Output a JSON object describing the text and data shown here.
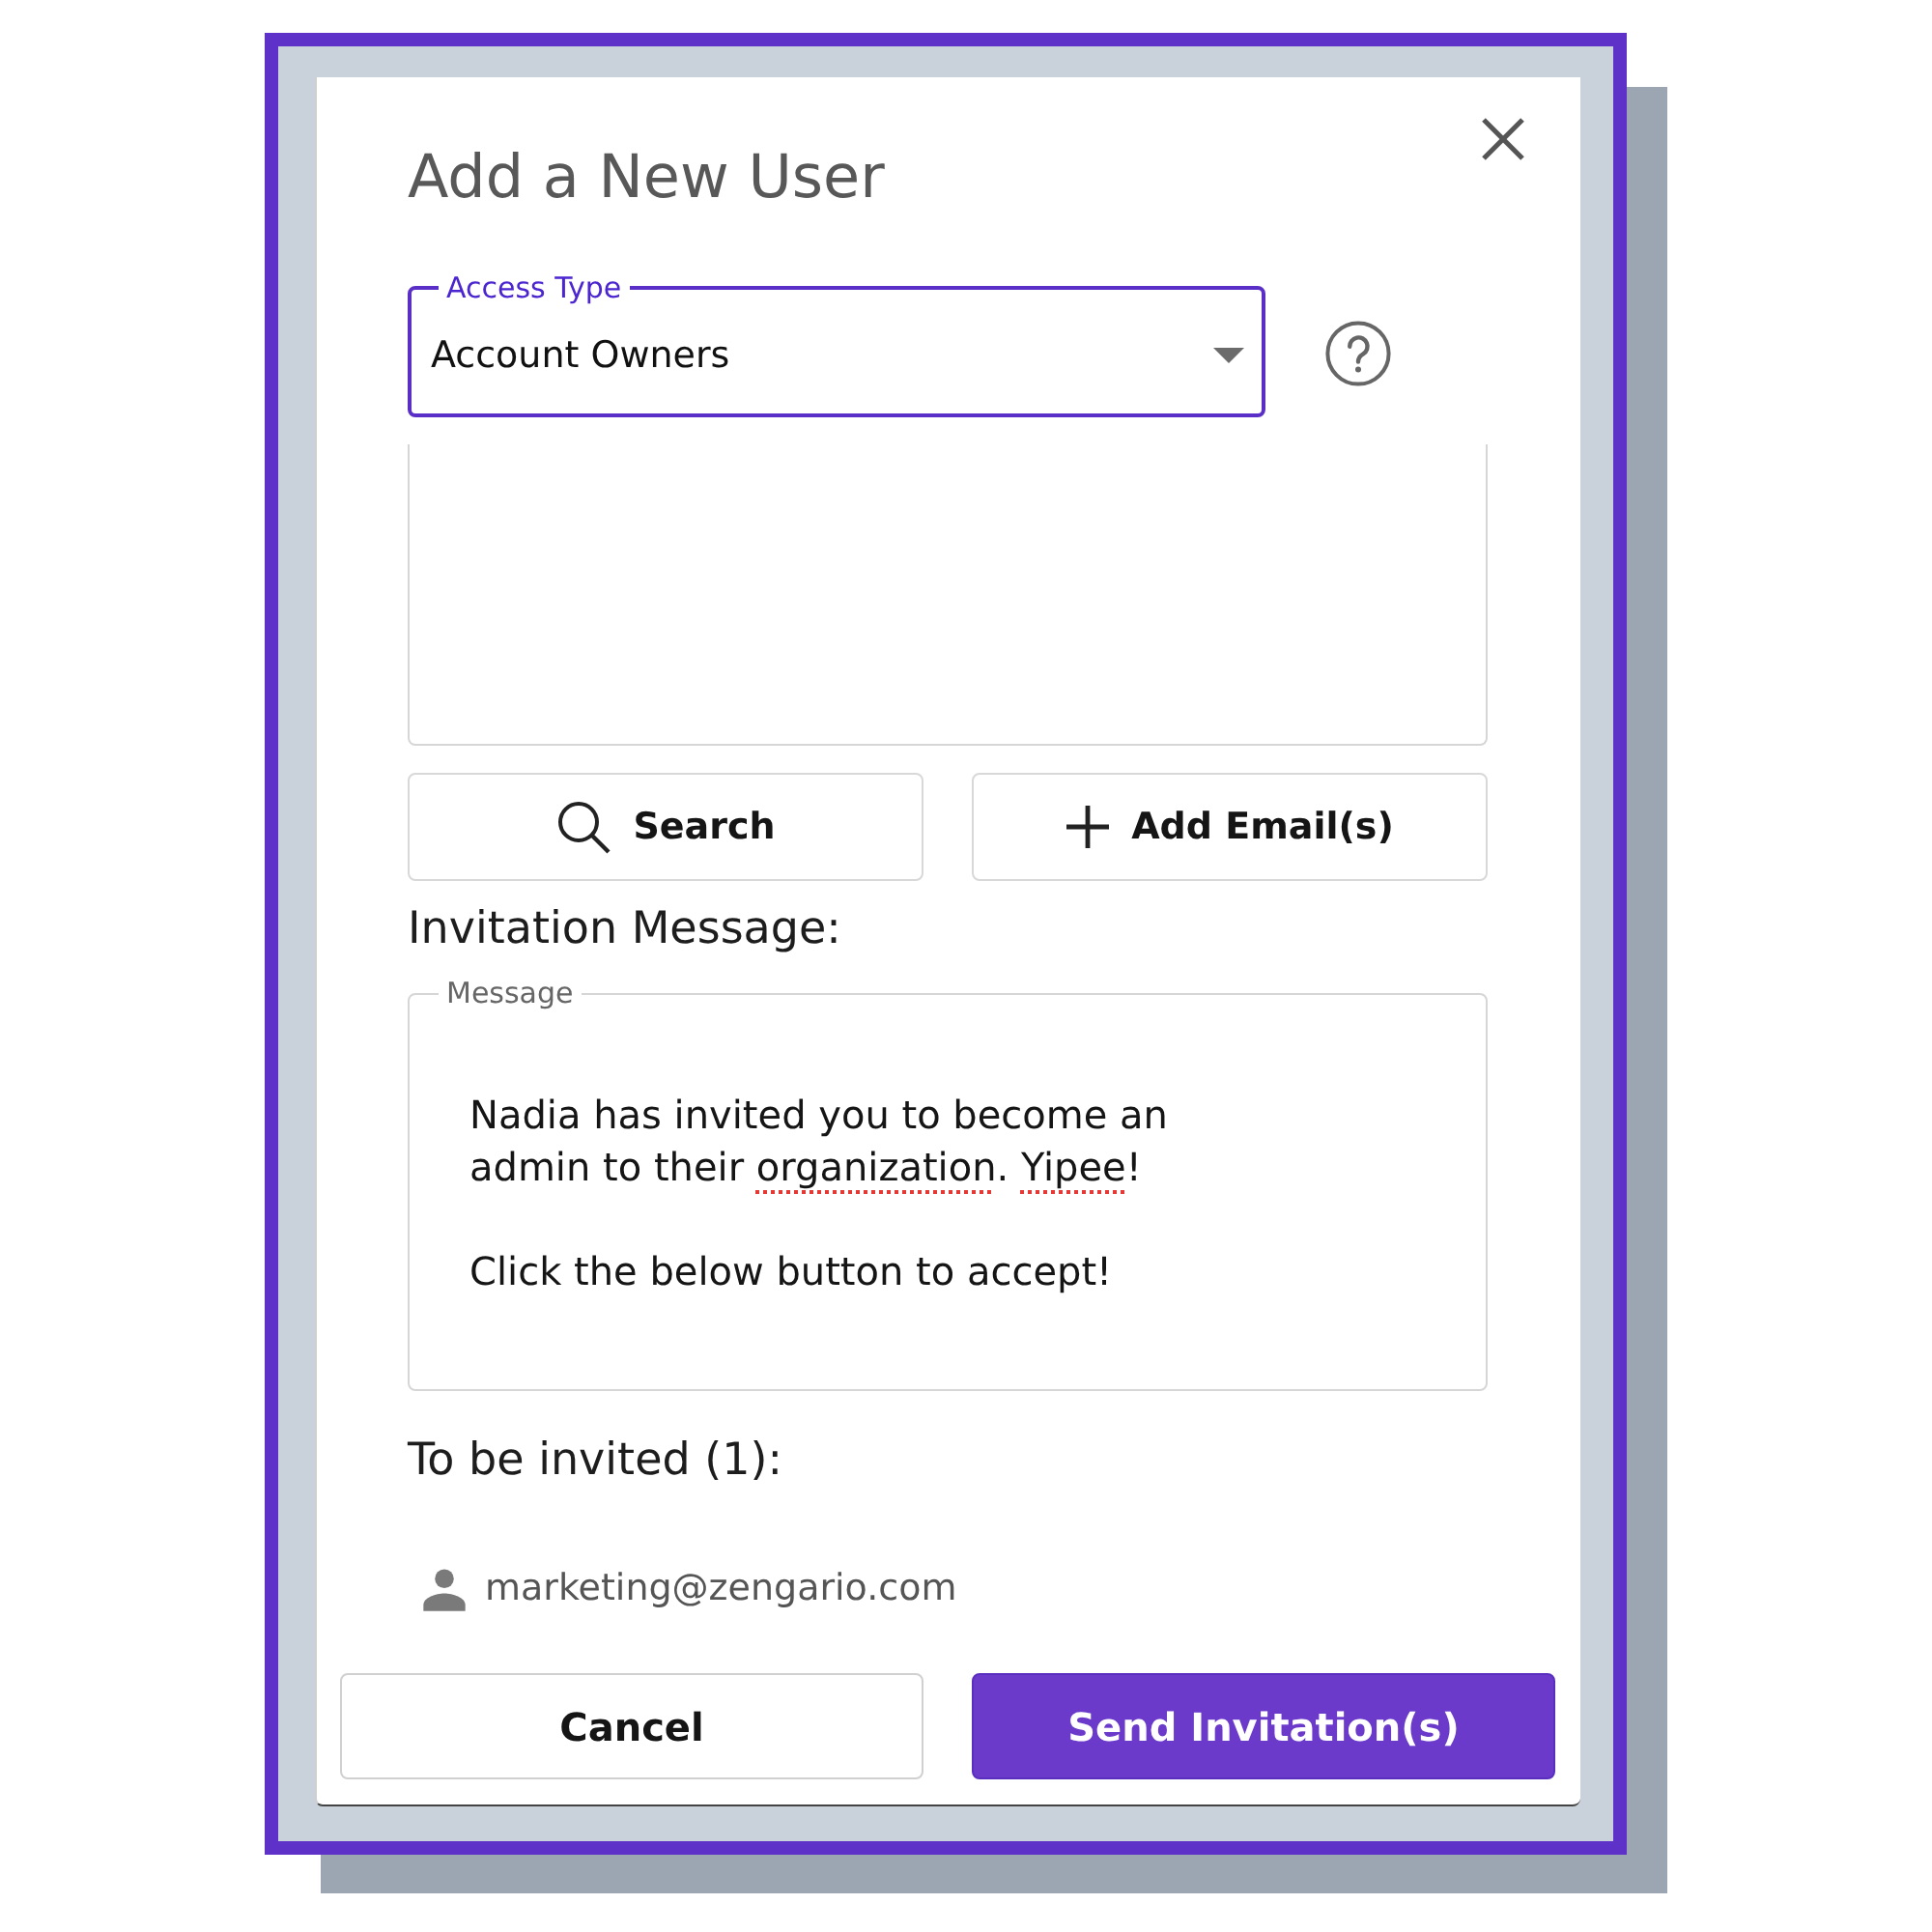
{
  "dialog": {
    "title": "Add a New User",
    "access_type": {
      "label": "Access Type",
      "value": "Account Owners",
      "focused": true
    },
    "actions": [
      {
        "label": "Search",
        "kind": "search"
      },
      {
        "label": "Add Email(s)",
        "kind": "add"
      }
    ],
    "message_heading": "Invitation Message:",
    "message": {
      "label": "Message",
      "segments": [
        {
          "text": "Nadia has invited you to become an\nadmin to their ",
          "misspelled": false
        },
        {
          "text": "organization",
          "misspelled": true
        },
        {
          "text": ". ",
          "misspelled": false
        },
        {
          "text": "Yipee",
          "misspelled": true
        },
        {
          "text": "!\n\nClick the below button to accept!",
          "misspelled": false
        }
      ]
    },
    "invited_heading": "To be invited (1):",
    "invitees": [
      {
        "email": "marketing@zengario.com"
      }
    ],
    "buttons": [
      {
        "label": "Cancel",
        "primary": false
      },
      {
        "label": "Send Invitation(s)",
        "primary": true
      }
    ]
  }
}
